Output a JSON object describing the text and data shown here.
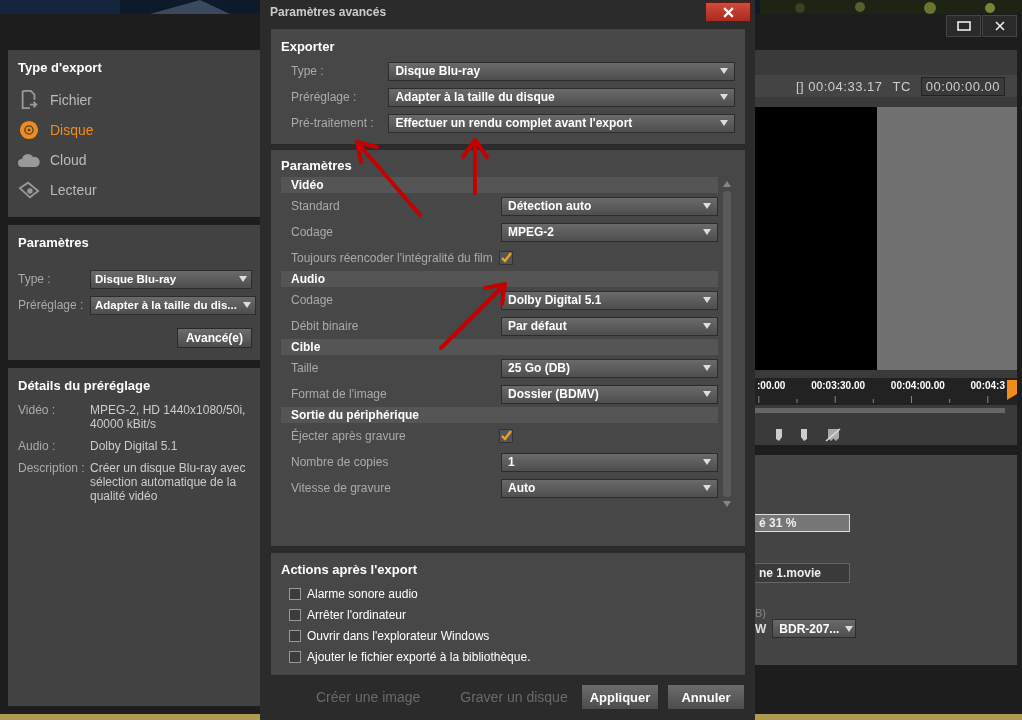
{
  "export_type": {
    "title": "Type d'export",
    "items": [
      {
        "kind": "file",
        "label": "Fichier",
        "selected": false
      },
      {
        "kind": "disc",
        "label": "Disque",
        "selected": true
      },
      {
        "kind": "cloud",
        "label": "Cloud",
        "selected": false
      },
      {
        "kind": "player",
        "label": "Lecteur",
        "selected": false
      }
    ]
  },
  "settings": {
    "title": "Paramètres",
    "fields": [
      {
        "label": "Type :",
        "value": "Disque Blu-ray"
      },
      {
        "label": "Préréglage :",
        "value": "Adapter à la taille du dis..."
      }
    ],
    "advanced_button": "Avancé(e)"
  },
  "preset_details": {
    "title": "Détails du préréglage",
    "rows": [
      {
        "label": "Vidéo :",
        "value": "MPEG-2, HD 1440x1080/50i, 40000 kBit/s"
      },
      {
        "label": "Audio :",
        "value": "Dolby Digital 5.1"
      },
      {
        "label": "Description :",
        "value": "Créer un disque Blu-ray avec sélection automatique de la qualité vidéo"
      }
    ]
  },
  "preview": {
    "duration": "[] 00:04:33.17",
    "tc_label": "TC",
    "tc_value": "00:00:00.00",
    "ruler_labels": [
      ":00.00",
      "00:03:30.00",
      "00:04:00.00",
      "00:04:3"
    ]
  },
  "output_panel": {
    "progress_text": "é 31 %",
    "file_name": "ne 1.movie",
    "drive_label": "B)",
    "drive_letter": "W",
    "drive_value": "BDR-207..."
  },
  "background_texts": {
    "buttons": [
      "Créer une image",
      "Graver un disque"
    ]
  },
  "dialog": {
    "title": "Paramètres avancés",
    "exporter": {
      "title": "Exporter",
      "fields": [
        {
          "label": "Type :",
          "value": "Disque Blu-ray"
        },
        {
          "label": "Préréglage :",
          "value": "Adapter à la taille du disque"
        },
        {
          "label": "Pré-traitement :",
          "value": "Effectuer un rendu complet avant l'export"
        }
      ]
    },
    "parameters": {
      "title": "Paramètres",
      "groups": [
        {
          "title": "Vidéo",
          "rows": [
            {
              "kind": "select",
              "label": "Standard",
              "value": "Détection auto"
            },
            {
              "kind": "select",
              "label": "Codage",
              "value": "MPEG-2"
            },
            {
              "kind": "checkbox",
              "label": "Toujours réencoder l'intégralité du film",
              "checked": true
            }
          ]
        },
        {
          "title": "Audio",
          "rows": [
            {
              "kind": "select",
              "label": "Codage",
              "value": "Dolby Digital 5.1"
            },
            {
              "kind": "select",
              "label": "Débit binaire",
              "value": "Par défaut"
            }
          ]
        },
        {
          "title": "Cible",
          "rows": [
            {
              "kind": "select",
              "label": "Taille",
              "value": "25 Go (DB)"
            },
            {
              "kind": "select",
              "label": "Format de l'image",
              "value": "Dossier (BDMV)"
            }
          ]
        },
        {
          "title": "Sortie du périphérique",
          "rows": [
            {
              "kind": "checkbox",
              "label": "Éjecter après gravure",
              "checked": true
            },
            {
              "kind": "select",
              "label": "Nombre de copies",
              "value": "1"
            },
            {
              "kind": "select",
              "label": "Vitesse de gravure",
              "value": "Auto"
            }
          ]
        }
      ]
    },
    "after_export": {
      "title": "Actions après l'export",
      "options": [
        {
          "label": "Alarme sonore audio",
          "checked": false
        },
        {
          "label": "Arrêter l'ordinateur",
          "checked": false
        },
        {
          "label": "Ouvrir dans l'explorateur Windows",
          "checked": false
        },
        {
          "label": "Ajouter le fichier exporté à la bibliothèque.",
          "checked": false
        }
      ]
    },
    "buttons": [
      "Appliquer",
      "Annuler"
    ]
  }
}
